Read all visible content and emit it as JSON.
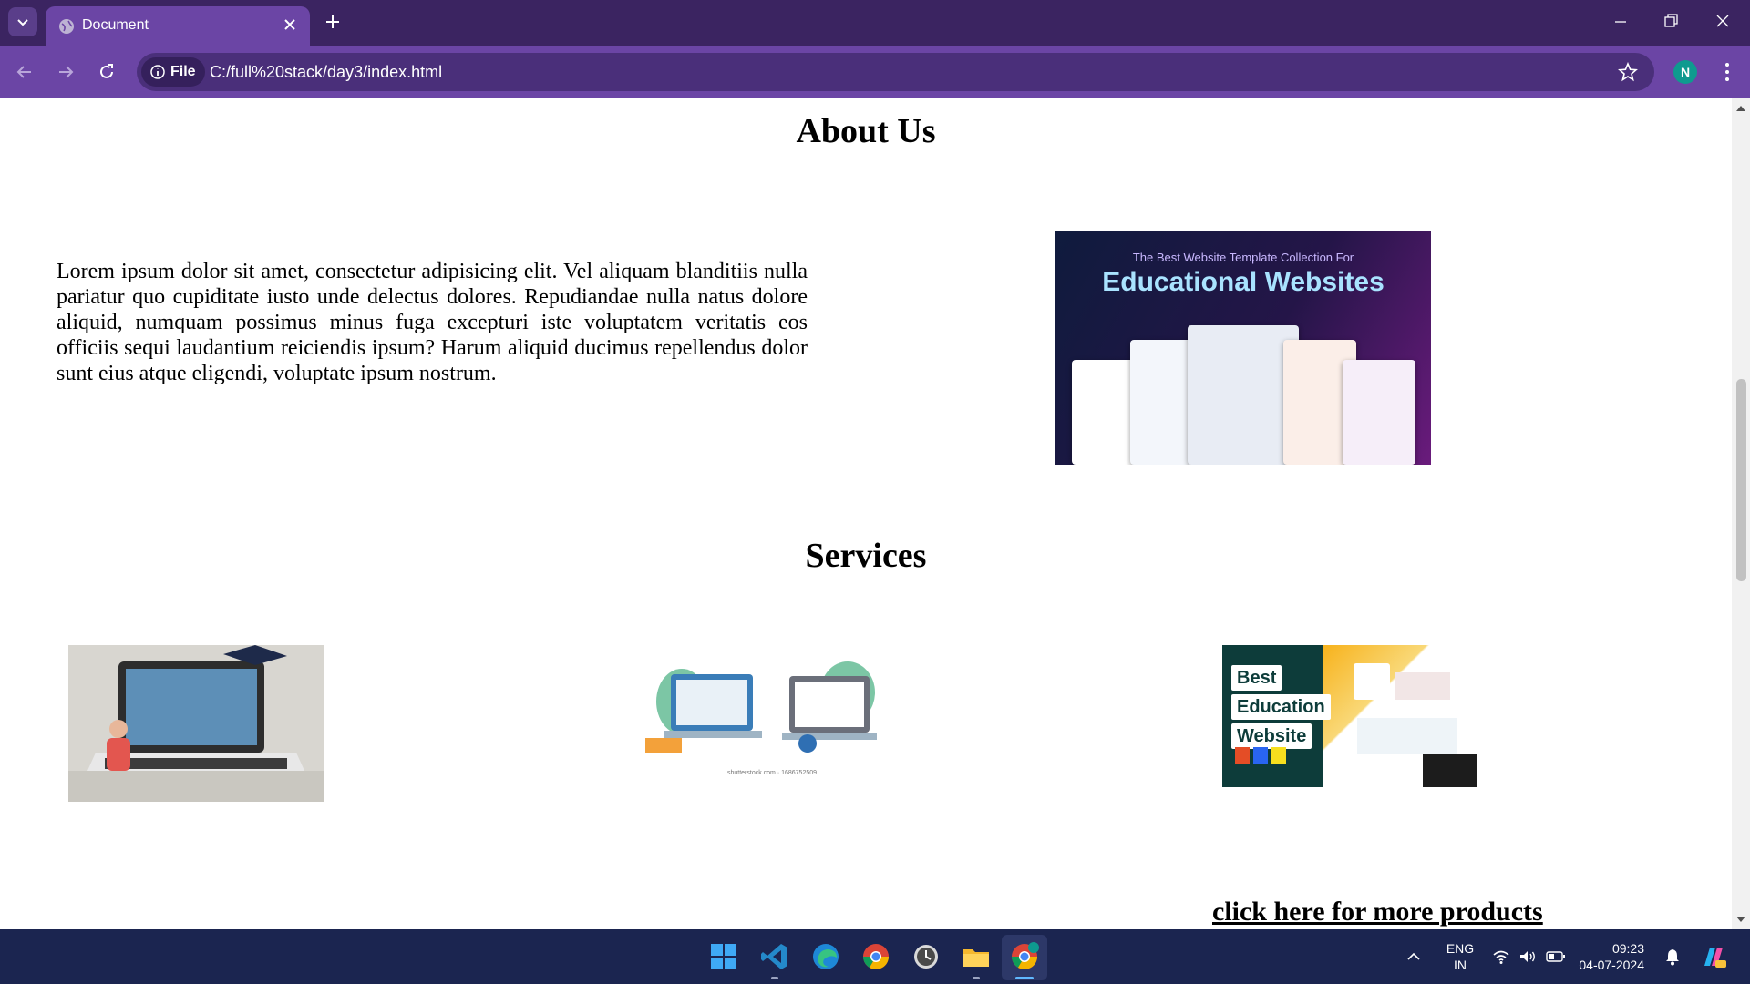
{
  "browser": {
    "tab_title": "Document",
    "site_chip_label": "File",
    "url": "C:/full%20stack/day3/index.html",
    "profile_initial": "N",
    "icons": [
      "tab-search-icon",
      "globe-icon",
      "close-icon",
      "plus-icon",
      "minimize-icon",
      "restore-icon",
      "window-close-icon",
      "back-icon",
      "forward-icon",
      "reload-icon",
      "info-icon",
      "star-icon",
      "kebab-menu-icon"
    ]
  },
  "page": {
    "about_heading": "About Us",
    "about_text": "Lorem ipsum dolor sit amet, consectetur adipisicing elit. Vel aliquam blanditiis nulla pariatur quo cupiditate iusto unde delectus dolores. Repudiandae nulla natus dolore aliquid, numquam possimus minus fuga excepturi iste voluptatem veritatis eos officiis sequi laudantium reiciendis ipsum? Harum aliquid ducimus repellendus dolor sunt eius atque eligendi, voluptate ipsum nostrum.",
    "about_image": {
      "subtitle": "The Best Website Template Collection For",
      "title": "Educational Websites"
    },
    "services_heading": "Services",
    "service_images": [
      {
        "name": "laptop-graduate-illustration"
      },
      {
        "name": "online-learning-illustration",
        "caption": "shutterstock.com · 1686752509"
      },
      {
        "name": "best-education-website-banner",
        "words": [
          "Best",
          "Education",
          "Website"
        ]
      }
    ],
    "more_link": "click here for more products"
  },
  "taskbar": {
    "language_line1": "ENG",
    "language_line2": "IN",
    "time": "09:23",
    "date": "04-07-2024"
  },
  "colors": {
    "tabbar_bg": "#3b2461",
    "toolbar_bg": "#6b45a5",
    "taskbar_bg": "#1b2550"
  }
}
